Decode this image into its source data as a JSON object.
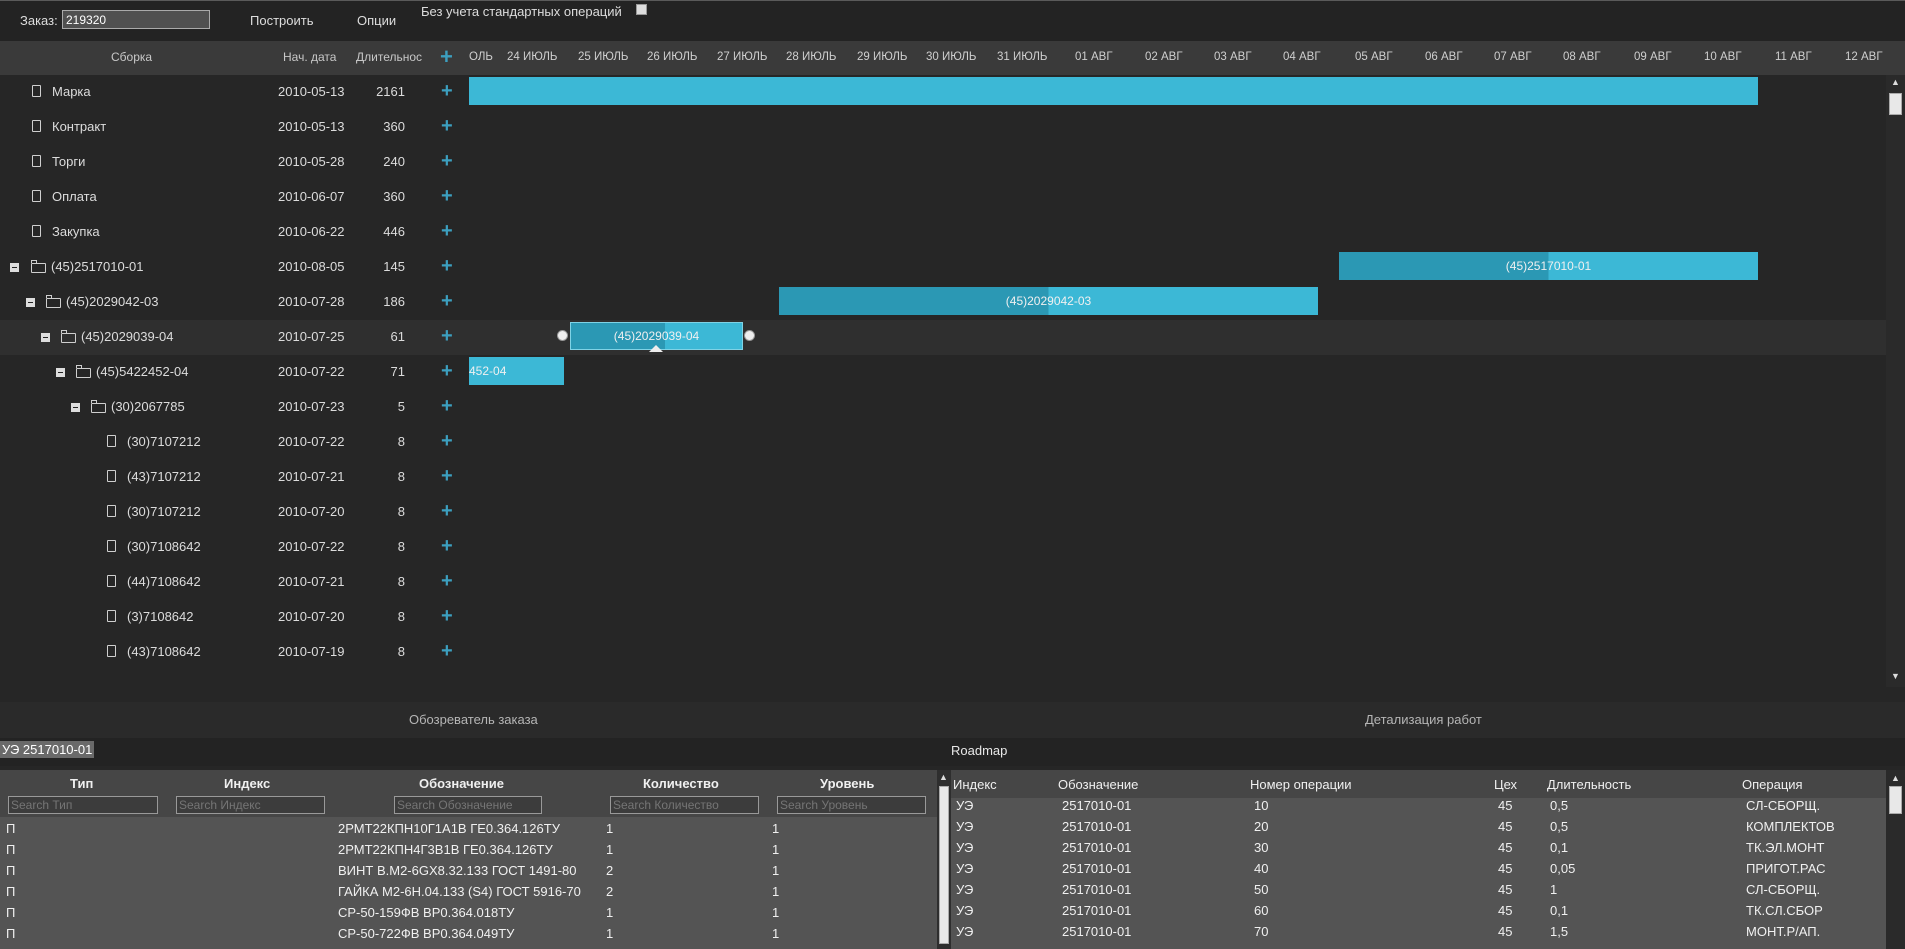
{
  "toolbar": {
    "order_label": "Заказ:",
    "order_value": "219320",
    "build_label": "Построить",
    "options_label": "Опции",
    "std_ops_label": "Без учета стандартных операций"
  },
  "tree_header": {
    "assembly": "Сборка",
    "start_date": "Нач. дата",
    "duration": "Длительнос"
  },
  "timeline_days": [
    "ОЛЬ",
    "24 ИЮЛЬ",
    "25 ИЮЛЬ",
    "26 ИЮЛЬ",
    "27 ИЮЛЬ",
    "28 ИЮЛЬ",
    "29 ИЮЛЬ",
    "30 ИЮЛЬ",
    "31 ИЮЛЬ",
    "01 АВГ",
    "02 АВГ",
    "03 АВГ",
    "04 АВГ",
    "05 АВГ",
    "06 АВГ",
    "07 АВГ",
    "08 АВГ",
    "09 АВГ",
    "10 АВГ",
    "11 АВГ",
    "12 АВГ"
  ],
  "tree_rows": [
    {
      "name": "Марка",
      "date": "2010-05-13",
      "dur": "2161"
    },
    {
      "name": "Контракт",
      "date": "2010-05-13",
      "dur": "360"
    },
    {
      "name": "Торги",
      "date": "2010-05-28",
      "dur": "240"
    },
    {
      "name": "Оплата",
      "date": "2010-06-07",
      "dur": "360"
    },
    {
      "name": "Закупка",
      "date": "2010-06-22",
      "dur": "446"
    },
    {
      "name": "(45)2517010-01",
      "date": "2010-08-05",
      "dur": "145"
    },
    {
      "name": "(45)2029042-03",
      "date": "2010-07-28",
      "dur": "186"
    },
    {
      "name": "(45)2029039-04",
      "date": "2010-07-25",
      "dur": "61"
    },
    {
      "name": "(45)5422452-04",
      "date": "2010-07-22",
      "dur": "71"
    },
    {
      "name": "(30)2067785",
      "date": "2010-07-23",
      "dur": "5"
    },
    {
      "name": "(30)7107212",
      "date": "2010-07-22",
      "dur": "8"
    },
    {
      "name": "(43)7107212",
      "date": "2010-07-21",
      "dur": "8"
    },
    {
      "name": "(30)7107212",
      "date": "2010-07-20",
      "dur": "8"
    },
    {
      "name": "(30)7108642",
      "date": "2010-07-22",
      "dur": "8"
    },
    {
      "name": "(44)7108642",
      "date": "2010-07-21",
      "dur": "8"
    },
    {
      "name": "(3)7108642",
      "date": "2010-07-20",
      "dur": "8"
    },
    {
      "name": "(43)7108642",
      "date": "2010-07-19",
      "dur": "8"
    }
  ],
  "gantt_bars": {
    "b1": "(45)2517010-01",
    "b2": "(45)2029042-03",
    "b3": "(45)2029039-04",
    "b4": "452-04"
  },
  "tabs": {
    "explorer": "Обозреватель заказа",
    "details": "Детализация работ"
  },
  "roadmap": {
    "badge": "УЭ 2517010-01",
    "title": "Roadmap"
  },
  "left_table": {
    "headers": [
      "Тип",
      "Индекс",
      "Обозначение",
      "Количество",
      "Уровень"
    ],
    "placeholders": [
      "Search Тип",
      "Search Индекс",
      "Search Обозначение",
      "Search Количество",
      "Search Уровень"
    ],
    "rows": [
      [
        "П",
        "2РМТ22КПН10Г1А1В ГЕ0.364.126ТУ",
        "1",
        "1"
      ],
      [
        "П",
        "2РМТ22КПН4Г3В1В ГЕ0.364.126ТУ",
        "1",
        "1"
      ],
      [
        "П",
        "ВИНТ В.М2-6GX8.32.133 ГОСТ 1491-80",
        "2",
        "1"
      ],
      [
        "П",
        "ГАЙКА М2-6Н.04.133 (S4) ГОСТ 5916-70",
        "2",
        "1"
      ],
      [
        "П",
        "СР-50-159ФВ ВР0.364.018ТУ",
        "1",
        "1"
      ],
      [
        "П",
        "СР-50-722ФВ ВР0.364.049ТУ",
        "1",
        "1"
      ]
    ]
  },
  "right_table": {
    "headers": [
      "Индекс",
      "Обозначение",
      "Номер операции",
      "Цех",
      "Длительность",
      "Операция"
    ],
    "rows": [
      [
        "УЭ",
        "2517010-01",
        "10",
        "45",
        "0,5",
        "СЛ-СБОРЩ."
      ],
      [
        "УЭ",
        "2517010-01",
        "20",
        "45",
        "0,5",
        "КОМПЛЕКТОВ"
      ],
      [
        "УЭ",
        "2517010-01",
        "30",
        "45",
        "0,1",
        "ТК.ЭЛ.МОНТ"
      ],
      [
        "УЭ",
        "2517010-01",
        "40",
        "45",
        "0,05",
        "ПРИГОТ.РАС"
      ],
      [
        "УЭ",
        "2517010-01",
        "50",
        "45",
        "1",
        "СЛ-СБОРЩ."
      ],
      [
        "УЭ",
        "2517010-01",
        "60",
        "45",
        "0,1",
        "ТК.СЛ.СБОР"
      ],
      [
        "УЭ",
        "2517010-01",
        "70",
        "45",
        "1,5",
        "МОНТ.Р/АП."
      ]
    ]
  }
}
